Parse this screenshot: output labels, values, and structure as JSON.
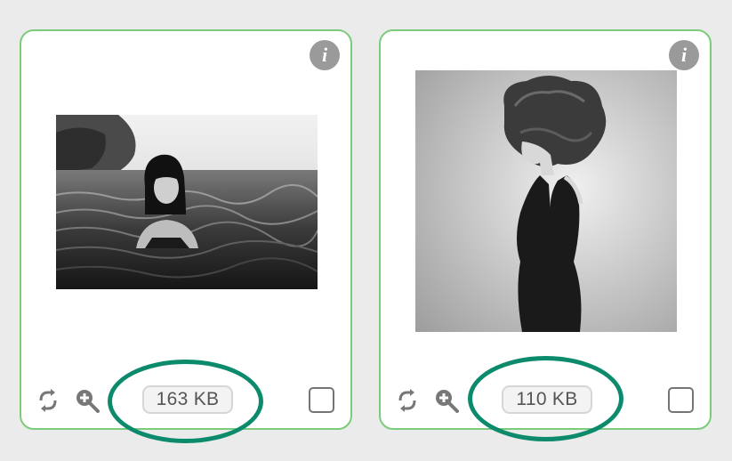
{
  "cards": [
    {
      "info_icon": "i",
      "thumbnail": "woman-in-sea-bw-photo",
      "file_size": "163 KB",
      "selected": false
    },
    {
      "info_icon": "i",
      "thumbnail": "woman-black-dress-profile-bw-photo",
      "file_size": "110 KB",
      "selected": false
    }
  ],
  "icons": {
    "info": "info-icon",
    "rotate": "rotate-icon",
    "zoom": "zoom-in-icon",
    "checkbox": "checkbox-icon"
  },
  "colors": {
    "card_border": "#7ccb7c",
    "highlight_ring": "#0c8a6c",
    "icon_gray": "#757575"
  }
}
